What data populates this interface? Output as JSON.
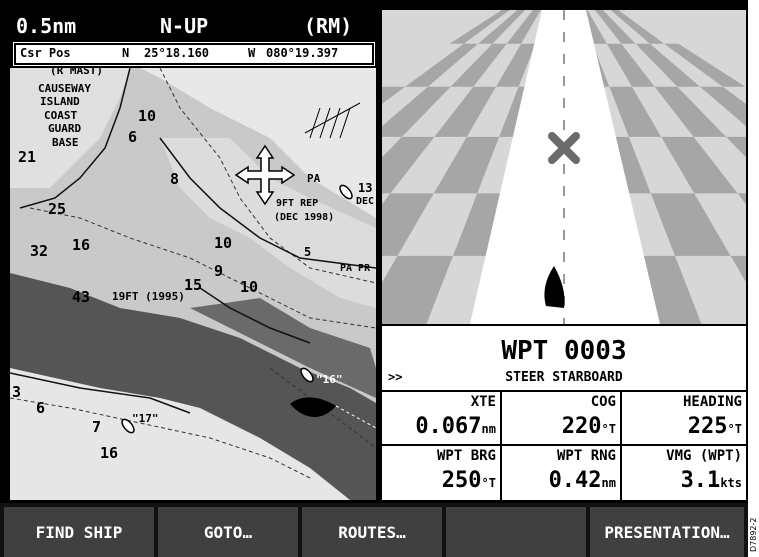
{
  "chart": {
    "scale": "0.5nm",
    "orientation": "N-UP",
    "motion_mode": "(RM)",
    "cursor_label": "Csr Pos",
    "lat_hemi": "N",
    "lat": "25°18.160",
    "lon_hemi": "W",
    "lon": "080°19.397",
    "place_labels": [
      "(R MAST)",
      "CAUSEWAY",
      "ISLAND",
      "COAST",
      "GUARD",
      "BASE",
      "9FT REP",
      "(DEC 1998)",
      "PA",
      "PA PR",
      "DEC",
      "19FT (1995)"
    ],
    "soundings": [
      "10",
      "6",
      "21",
      "8",
      "25",
      "32",
      "16",
      "43",
      "15",
      "10",
      "9",
      "10",
      "5",
      "13",
      "6",
      "7",
      "3",
      "16"
    ],
    "tags": [
      "\"16\"",
      "\"17\""
    ]
  },
  "waypoint": {
    "name": "WPT 0003",
    "arrows": ">>",
    "steer": "STEER STARBOARD"
  },
  "readouts": [
    {
      "label": "XTE",
      "value": "0.067",
      "unit": "nm"
    },
    {
      "label": "COG",
      "value": "220",
      "unit": "°T"
    },
    {
      "label": "HEADING",
      "value": "225",
      "unit": "°T"
    },
    {
      "label": "WPT BRG",
      "value": "250",
      "unit": "°T"
    },
    {
      "label": "WPT RNG",
      "value": "0.42",
      "unit": "nm"
    },
    {
      "label": "VMG (WPT)",
      "value": "3.1",
      "unit": "kts"
    }
  ],
  "softkeys": [
    "FIND SHIP",
    "GOTO…",
    "ROUTES…",
    "",
    "PRESENTATION…"
  ],
  "figure_ref": "D7892-2",
  "colors": {
    "land": "#e8e8e8",
    "shallow": "#c9c9c9",
    "channel": "#555555",
    "background": "#000000",
    "softkey": "#404040",
    "checker_dark": "#a6a6a6",
    "checker_light": "#d7d7d7",
    "waypoint_marker": "#6b6b6b"
  },
  "icons": [
    "cursor-move-icon",
    "vessel-icon",
    "waypoint-marker-icon",
    "cursor-icon"
  ]
}
